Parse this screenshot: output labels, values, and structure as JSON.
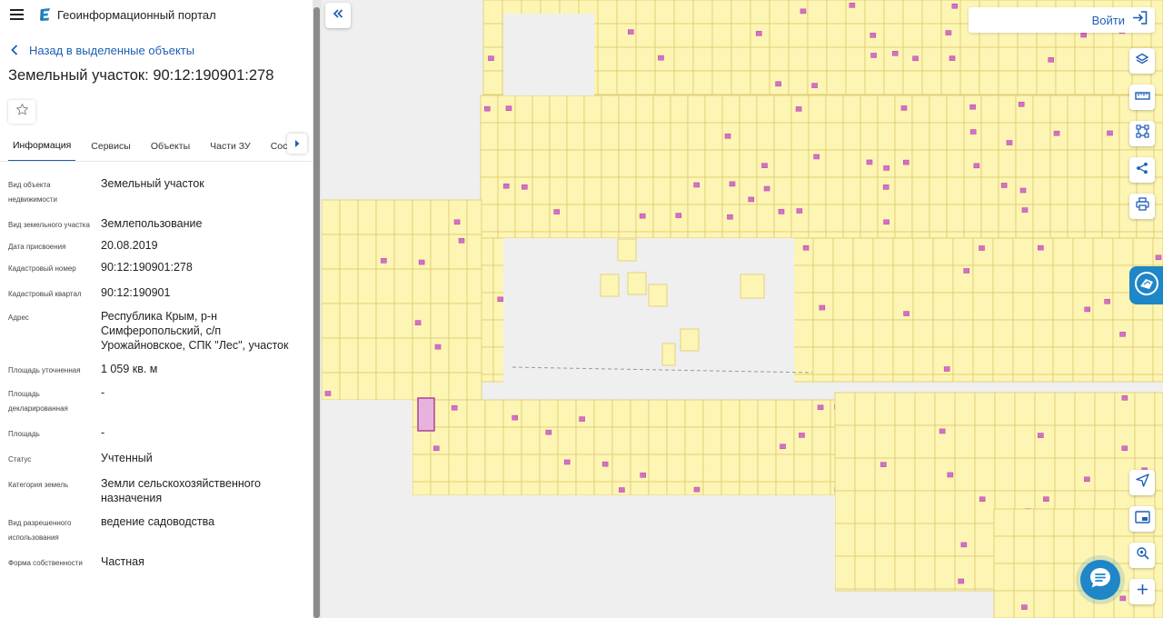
{
  "header": {
    "portal_title": "Геоинформационный портал"
  },
  "panel": {
    "back_link": "Назад в выделенные объекты",
    "object_title": "Земельный участок: 90:12:190901:278",
    "tabs": [
      {
        "label": "Информация",
        "active": true
      },
      {
        "label": "Сервисы"
      },
      {
        "label": "Объекты"
      },
      {
        "label": "Части ЗУ"
      },
      {
        "label": "Состав"
      }
    ],
    "info": [
      {
        "label": "Вид объекта недвижимости",
        "value": "Земельный участок"
      },
      {
        "label": "Вид земельного участка",
        "value": "Землепользование"
      },
      {
        "label": "Дата присвоения",
        "value": "20.08.2019"
      },
      {
        "label": "Кадастровый номер",
        "value": "90:12:190901:278"
      },
      {
        "label": "Кадастровый квартал",
        "value": "90:12:190901"
      },
      {
        "label": "Адрес",
        "value": "Республика Крым, р-н Симферопольский, с/п Урожайновское, СПК \"Лес\", участок"
      },
      {
        "label": "Площадь уточненная",
        "value": "1 059 кв. м"
      },
      {
        "label": "Площадь декларированная",
        "value": "-"
      },
      {
        "label": "Площадь",
        "value": "-"
      },
      {
        "label": "Статус",
        "value": "Учтенный"
      },
      {
        "label": "Категория земель",
        "value": "Земли сельскохозяйственного назначения"
      },
      {
        "label": "Вид разрешенного использования",
        "value": "ведение садоводства"
      },
      {
        "label": "Форма собственности",
        "value": "Частная"
      }
    ]
  },
  "map": {
    "login_label": "Войти",
    "colors": {
      "background": "#efefef",
      "parcel_fill": "#fdf5b4",
      "parcel_stroke": "#dccb70",
      "building_fill": "#d56fc9",
      "selected_stroke": "#a53b93",
      "accent": "#1e5fb4",
      "badge": "#1f86c7"
    },
    "right_tools_top": [
      "layers-icon",
      "ruler-icon",
      "select-area-icon",
      "share-icon",
      "print-icon"
    ],
    "right_tools_bottom": [
      "navigate-icon",
      "minimap-icon",
      "locate-icon",
      "zoom-in-icon"
    ]
  }
}
